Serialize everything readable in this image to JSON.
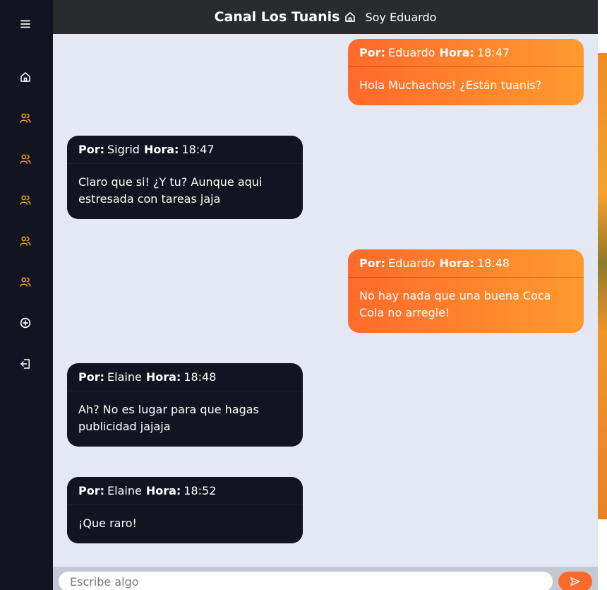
{
  "header": {
    "channel_title": "Canal Los Tuanis",
    "user_label": "Soy Eduardo"
  },
  "sidebar": {
    "items": [
      {
        "icon": "menu-icon",
        "color": "#ffffff"
      },
      {
        "icon": "home-icon",
        "color": "#ffffff"
      },
      {
        "icon": "users-icon",
        "color": "#f5a623"
      },
      {
        "icon": "users-icon",
        "color": "#f5a623"
      },
      {
        "icon": "users-icon",
        "color": "#f5a623"
      },
      {
        "icon": "users-icon",
        "color": "#f5a623"
      },
      {
        "icon": "users-icon",
        "color": "#f5a623"
      },
      {
        "icon": "add-circle-icon",
        "color": "#ffffff"
      },
      {
        "icon": "logout-icon",
        "color": "#ffffff"
      }
    ]
  },
  "labels": {
    "por": "Por:",
    "hora": "Hora:"
  },
  "messages": [
    {
      "author": "Eduardo",
      "time": "18:47",
      "text": "Hola Muchachos! ¿Están tuanis?",
      "mine": true
    },
    {
      "author": "Sigrid",
      "time": "18:47",
      "text": "Claro que si! ¿Y tu? Aunque aqui estresada con tareas jaja",
      "mine": false
    },
    {
      "author": "Eduardo",
      "time": "18:48",
      "text": "No hay nada que una buena Coca Cola no arregle!",
      "mine": true
    },
    {
      "author": "Elaine",
      "time": "18:48",
      "text": "Ah? No es lugar para que hagas publicidad jajaja",
      "mine": false
    },
    {
      "author": "Elaine",
      "time": "18:52",
      "text": "¡Que raro!",
      "mine": false
    }
  ],
  "composer": {
    "placeholder": "Escribe algo"
  },
  "colors": {
    "accent": "#ff7a2e",
    "sidebar_bg": "#121421",
    "chat_bg": "#e4e8f3"
  }
}
